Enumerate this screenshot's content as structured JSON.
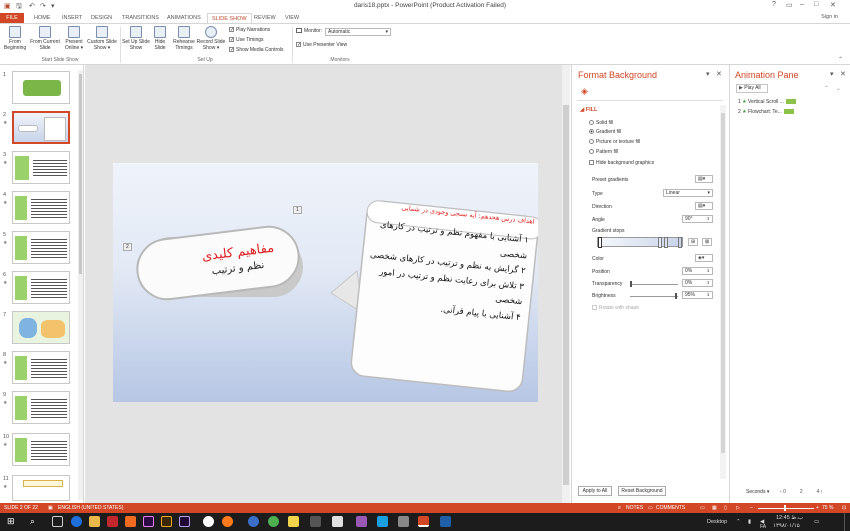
{
  "window": {
    "title": "daris18.pptx - PowerPoint (Product Activation Failed)",
    "controls": [
      "?",
      "▭",
      "–",
      "□",
      "✕"
    ]
  },
  "quick_access": {
    "save_icon": "save-icon",
    "undo_icon": "undo-icon",
    "redo_icon": "redo-icon",
    "customize_icon": "customize-icon"
  },
  "tabs": [
    "FILE",
    "HOME",
    "INSERT",
    "DESIGN",
    "TRANSITIONS",
    "ANIMATIONS",
    "SLIDE SHOW",
    "REVIEW",
    "VIEW"
  ],
  "active_tab": "SLIDE SHOW",
  "sign_in": "Sign in",
  "ribbon": {
    "start_group": {
      "label": "Start Slide Show",
      "buttons": [
        "From Beginning",
        "From Current Slide",
        "Present Online ▾",
        "Custom Slide Show ▾"
      ]
    },
    "setup_group": {
      "label": "Set Up",
      "buttons": [
        "Set Up Slide Show",
        "Hide Slide",
        "Rehearse Timings",
        "Record Slide Show ▾"
      ],
      "checks": [
        {
          "label": "Play Narrations",
          "checked": true
        },
        {
          "label": "Use Timings",
          "checked": true
        },
        {
          "label": "Show Media Controls",
          "checked": true
        }
      ]
    },
    "monitors_group": {
      "label": "Monitors",
      "monitor_label": "Monitor:",
      "monitor_value": "Automatic",
      "presenter_view": "Use Presenter View",
      "presenter_view_checked": true
    }
  },
  "slides": [
    {
      "num": "1"
    },
    {
      "num": "2",
      "selected": true
    },
    {
      "num": "3"
    },
    {
      "num": "4"
    },
    {
      "num": "5"
    },
    {
      "num": "6"
    },
    {
      "num": "7"
    },
    {
      "num": "8"
    },
    {
      "num": "9"
    },
    {
      "num": "10"
    },
    {
      "num": "11"
    }
  ],
  "slide": {
    "left_title": "مفاهیم کلیدی",
    "left_subtitle": "نظم و ترتیب",
    "right_header": "اهداف درس هجدهم: آیه سنجی وجودی در شمایی",
    "right_lines": [
      "۱ آشنایی با مفهوم نظم و ترتیب در کارهای",
      "شخصی",
      "۲ گرایش به نظم و ترتیب در کارهای شخصی",
      "۳ تلاش برای رعایت نظم و ترتیب در امور",
      "شخصی",
      "۴ آشنایی با پیام قرآنی."
    ],
    "anim_tag_1": "1",
    "anim_tag_2": "2"
  },
  "format_background": {
    "title": "Format Background",
    "section": "FILL",
    "fill_options": [
      {
        "label": "Solid fill",
        "selected": false
      },
      {
        "label": "Gradient fill",
        "selected": true
      },
      {
        "label": "Picture or texture fill",
        "selected": false
      },
      {
        "label": "Pattern fill",
        "selected": false
      }
    ],
    "hide_graphics": "Hide background graphics",
    "preset_gradients": "Preset gradients",
    "type_label": "Type",
    "type_value": "Linear",
    "direction_label": "Direction",
    "angle_label": "Angle",
    "angle_value": "90°",
    "gradient_stops": "Gradient stops",
    "color_label": "Color",
    "position_label": "Position",
    "position_value": "0%",
    "transparency_label": "Transparency",
    "transparency_value": "0%",
    "brightness_label": "Brightness",
    "brightness_value": "95%",
    "rotate_label": "Rotate with shape",
    "apply_all": "Apply to All",
    "reset": "Reset Background"
  },
  "animation_pane": {
    "title": "Animation Pane",
    "play_all": "Play All",
    "items": [
      {
        "num": "1",
        "name": "Vertical Scroll ..."
      },
      {
        "num": "2",
        "name": "Flowchart: Te..."
      }
    ],
    "seconds_label": "Seconds ▾",
    "scale": [
      "0",
      "2",
      "4"
    ]
  },
  "status": {
    "slide": "SLIDE 2 OF 22",
    "language": "ENGLISH (UNITED STATES)",
    "notes": "NOTES",
    "comments": "COMMENTS",
    "zoom": "75 %"
  },
  "taskbar": {
    "desktop": "Desktop",
    "time": "12:45 ب.ظ",
    "date": "۱۳۹۸/۰۱/۱۵",
    "lang": "FA"
  },
  "colors": {
    "accent": "#d24726",
    "ribbon_icon": "#7a8fb0",
    "taskbar": "#1c1c1c"
  }
}
